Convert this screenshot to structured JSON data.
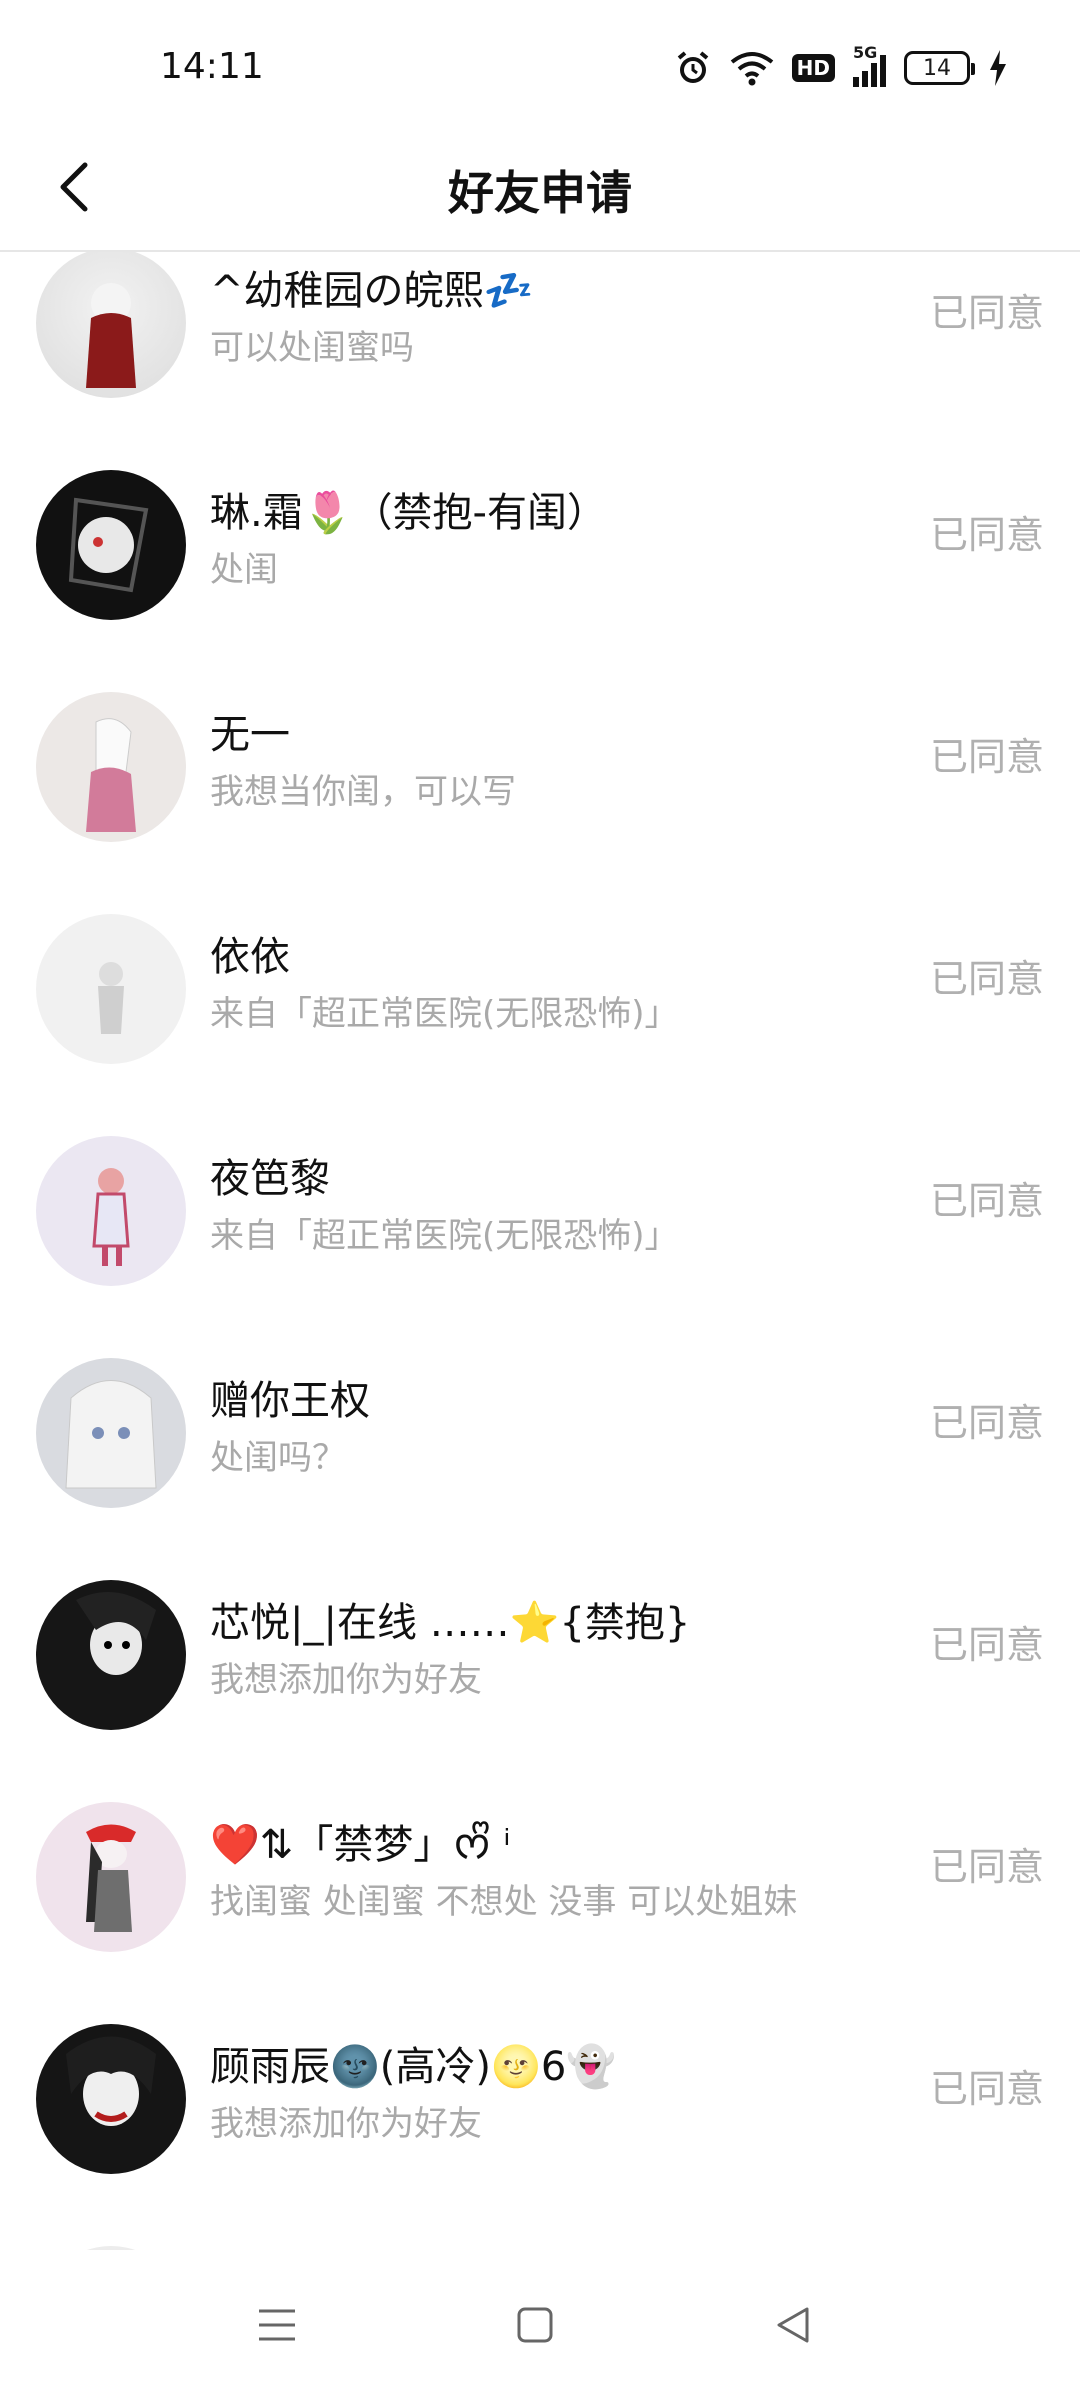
{
  "status_bar": {
    "time": "14:11",
    "network": "5G",
    "hd": "HD",
    "battery": "14",
    "icons": [
      "alarm-icon",
      "wifi-icon",
      "hd-icon",
      "signal-icon",
      "battery-icon",
      "charging-icon"
    ]
  },
  "header": {
    "title": "好友申请",
    "back_icon": "chevron-left-icon"
  },
  "requests": [
    {
      "name": "^幼稚园の皖熙💤",
      "message": "可以处闺蜜吗",
      "status": "已同意"
    },
    {
      "name": "琳.霜🌷（禁抱-有闺）",
      "message": "处闺",
      "status": "已同意"
    },
    {
      "name": "无一",
      "message": "我想当你闺，可以写",
      "status": "已同意"
    },
    {
      "name": "依依",
      "message": "来自「超正常医院(无限恐怖)」",
      "status": "已同意"
    },
    {
      "name": "夜笆黎",
      "message": "来自「超正常医院(无限恐怖)」",
      "status": "已同意"
    },
    {
      "name": "赠你王权",
      "message": "处闺吗？",
      "status": "已同意"
    },
    {
      "name": "芯悦|_|在线 ……⭐{禁抱}",
      "message": "我想添加你为好友",
      "status": "已同意"
    },
    {
      "name": "❤️⇅「禁梦」ᰔᩚ ⁱ",
      "message": "找闺蜜 处闺蜜 不想处 没事 可以处姐妹",
      "status": "已同意"
    },
    {
      "name": "顾雨辰🌚(高冷)🌝6👻",
      "message": "我想添加你为好友",
      "status": "已同意"
    }
  ],
  "nav_bar": {
    "icons": [
      "menu-icon",
      "home-square-icon",
      "back-triangle-icon"
    ]
  }
}
